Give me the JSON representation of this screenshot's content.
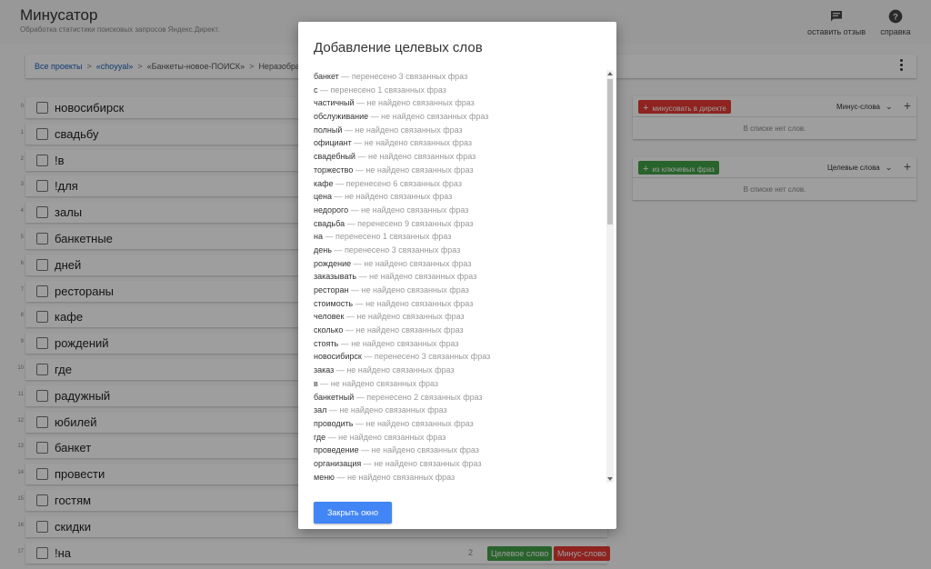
{
  "header": {
    "title": "Минусатор",
    "subtitle": "Обработка статистики поисковых запросов Яндекс.Директ.",
    "feedback_label": "оставить отзыв",
    "help_label": "справка"
  },
  "breadcrumb": {
    "items": [
      "Все проекты",
      "«choyyal»",
      "«Банкеты-новое-ПОИСК»",
      "Неразобра"
    ]
  },
  "words": [
    {
      "index": "0",
      "word": "новосибирск"
    },
    {
      "index": "1",
      "word": "свадьбу"
    },
    {
      "index": "2",
      "word": "!в"
    },
    {
      "index": "3",
      "word": "!для"
    },
    {
      "index": "4",
      "word": "залы"
    },
    {
      "index": "5",
      "word": "банкетные"
    },
    {
      "index": "6",
      "word": "дней"
    },
    {
      "index": "7",
      "word": "рестораны"
    },
    {
      "index": "8",
      "word": "кафе"
    },
    {
      "index": "9",
      "word": "рождений"
    },
    {
      "index": "10",
      "word": "где"
    },
    {
      "index": "11",
      "word": "радужный"
    },
    {
      "index": "12",
      "word": "юбилей"
    },
    {
      "index": "13",
      "word": "банкет"
    },
    {
      "index": "14",
      "word": "провести"
    },
    {
      "index": "15",
      "word": "гостям"
    },
    {
      "index": "16",
      "word": "скидки"
    },
    {
      "index": "17",
      "word": "!на",
      "count": "2",
      "target_label": "Целевое слово",
      "minus_label": "Минус-слово"
    }
  ],
  "panels": {
    "minus": {
      "button_label": "минусовать в директе",
      "select_value": "Минус-слова",
      "empty_text": "В списке нет слов."
    },
    "target": {
      "button_label": "из ключевых фраз",
      "select_value": "Целевые слова",
      "empty_text": "В списке нет слов."
    }
  },
  "modal": {
    "title": "Добавление целевых слов",
    "close_label": "Закрыть окно",
    "results": [
      {
        "word": "банкет",
        "status": "перенесено 3 связанных фраз"
      },
      {
        "word": "с",
        "status": "перенесено 1 связанных фраз"
      },
      {
        "word": "частичный",
        "status": "не найдено связанных фраз"
      },
      {
        "word": "обслуживание",
        "status": "не найдено связанных фраз"
      },
      {
        "word": "полный",
        "status": "не найдено связанных фраз"
      },
      {
        "word": "официант",
        "status": "не найдено связанных фраз"
      },
      {
        "word": "свадебный",
        "status": "не найдено связанных фраз"
      },
      {
        "word": "торжество",
        "status": "не найдено связанных фраз"
      },
      {
        "word": "кафе",
        "status": "перенесено 6 связанных фраз"
      },
      {
        "word": "цена",
        "status": "не найдено связанных фраз"
      },
      {
        "word": "недорого",
        "status": "не найдено связанных фраз"
      },
      {
        "word": "свадьба",
        "status": "перенесено 9 связанных фраз"
      },
      {
        "word": "на",
        "status": "перенесено 1 связанных фраз"
      },
      {
        "word": "день",
        "status": "перенесено 3 связанных фраз"
      },
      {
        "word": "рождение",
        "status": "не найдено связанных фраз"
      },
      {
        "word": "заказывать",
        "status": "не найдено связанных фраз"
      },
      {
        "word": "ресторан",
        "status": "не найдено связанных фраз"
      },
      {
        "word": "стоимость",
        "status": "не найдено связанных фраз"
      },
      {
        "word": "человек",
        "status": "не найдено связанных фраз"
      },
      {
        "word": "сколько",
        "status": "не найдено связанных фраз"
      },
      {
        "word": "стоять",
        "status": "не найдено связанных фраз"
      },
      {
        "word": "новосибирск",
        "status": "перенесено 3 связанных фраз"
      },
      {
        "word": "заказ",
        "status": "не найдено связанных фраз"
      },
      {
        "word": "в",
        "status": "не найдено связанных фраз"
      },
      {
        "word": "банкетный",
        "status": "перенесено 2 связанных фраз"
      },
      {
        "word": "зал",
        "status": "не найдено связанных фраз"
      },
      {
        "word": "проводить",
        "status": "не найдено связанных фраз"
      },
      {
        "word": "где",
        "status": "не найдено связанных фраз"
      },
      {
        "word": "проведение",
        "status": "не найдено связанных фраз"
      },
      {
        "word": "организация",
        "status": "не найдено связанных фраз"
      },
      {
        "word": "меню",
        "status": "не найдено связанных фраз"
      }
    ]
  },
  "colors": {
    "accent_blue": "#4285f4",
    "minus_red": "#e53935",
    "target_green": "#43a047",
    "link_blue": "#1a5fb4"
  }
}
